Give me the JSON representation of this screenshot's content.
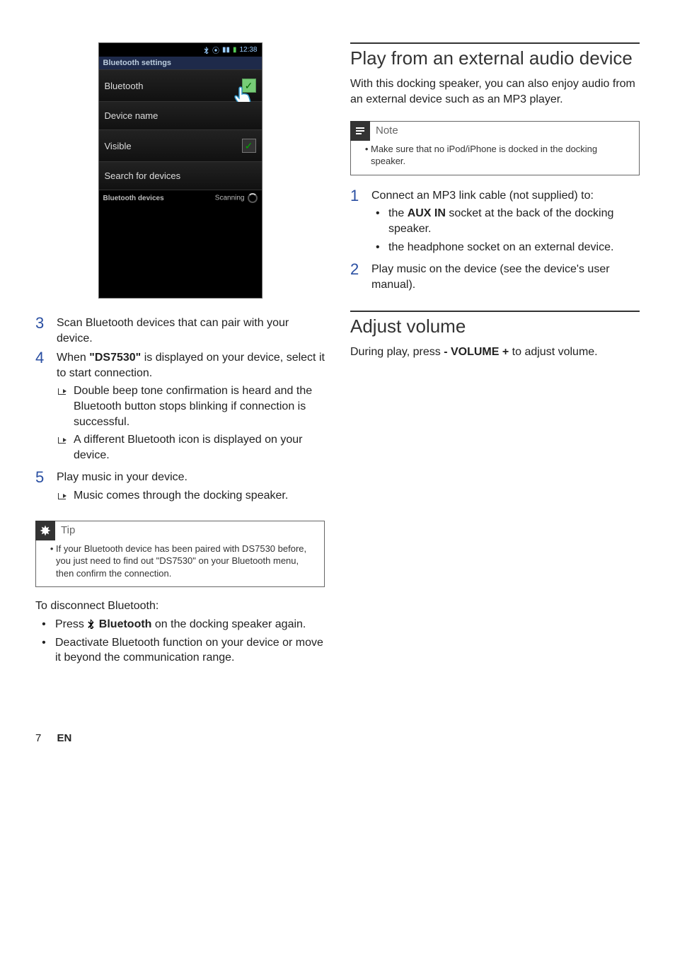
{
  "phone": {
    "time": "12:38",
    "section_title": "Bluetooth settings",
    "rows": {
      "bt": "Bluetooth",
      "devname": "Device name",
      "visible": "Visible",
      "search": "Search for devices"
    },
    "devices_label": "Bluetooth devices",
    "scanning": "Scanning"
  },
  "left": {
    "step3": "Scan Bluetooth devices that can pair with your device.",
    "step4_pre": "When ",
    "step4_name": "\"DS7530\"",
    "step4_post": " is displayed on your device, select it to start connection.",
    "step4_sub1": "Double beep tone confirmation is heard and the Bluetooth button stops blinking if connection is successful.",
    "step4_sub2": "A different Bluetooth icon is displayed on your device.",
    "step5": "Play music in your device.",
    "step5_sub1": "Music comes through the docking speaker.",
    "tip_label": "Tip",
    "tip_text": "If your Bluetooth device has been paired with DS7530 before, you just need to find out \"DS7530\" on your Bluetooth menu, then confirm the connection.",
    "disc_head": "To disconnect Bluetooth:",
    "disc_b1_pre": "Press ",
    "disc_b1_bold": " Bluetooth",
    "disc_b1_post": " on the docking speaker again.",
    "disc_b2": "Deactivate Bluetooth function on your device or move it beyond the communication range."
  },
  "right": {
    "h_play": "Play from an external audio device",
    "play_para": "With this docking speaker, you can also enjoy audio from an external device such as an MP3 player.",
    "note_label": "Note",
    "note_text": "Make sure that no iPod/iPhone is docked in the docking speaker.",
    "step1": "Connect an MP3 link cable (not supplied) to:",
    "step1_s1_pre": "the ",
    "step1_s1_bold": "AUX IN",
    "step1_s1_post": "  socket at the back of the docking speaker.",
    "step1_s2": "the headphone socket on an external device.",
    "step2": "Play music on the device (see the device's user manual).",
    "h_vol": "Adjust volume",
    "vol_pre": "During play, press ",
    "vol_bold": "- VOLUME +",
    "vol_post": " to adjust volume."
  },
  "footer": {
    "page": "7",
    "lang": "EN"
  }
}
